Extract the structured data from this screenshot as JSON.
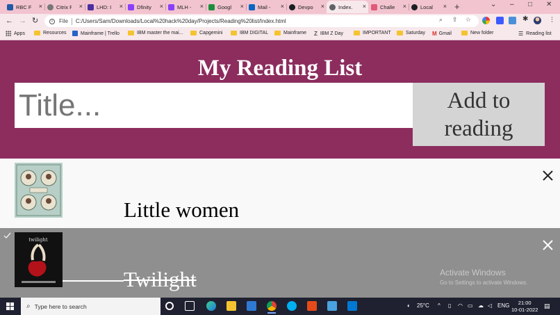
{
  "browser": {
    "tabs": [
      {
        "label": "RBC Fi",
        "color": "#1f5aa6"
      },
      {
        "label": "Citrix F",
        "color": "#555555"
      },
      {
        "label": "LHD: I",
        "color": "#4b2fa0"
      },
      {
        "label": "Dfinity",
        "color": "#8a3ffc"
      },
      {
        "label": "MLH -",
        "color": "#8a3ffc"
      },
      {
        "label": "Googl",
        "color": "#1e8e3e"
      },
      {
        "label": "Mail -",
        "color": "#0a66c2"
      },
      {
        "label": "Devpo",
        "color": "#1b1f23"
      },
      {
        "label": "Index.",
        "color": "#5f6368"
      },
      {
        "label": "Challe",
        "color": "#e05a7a"
      },
      {
        "label": "Local",
        "color": "#1b1f23"
      }
    ],
    "url_scheme": "File",
    "url": "C:/Users/Sam/Downloads/Local%20hack%20day/Projects/Reading%20list/Index.html",
    "bookmarks": [
      {
        "label": "Apps",
        "icon": "apps-grid-icon"
      },
      {
        "label": "Resources",
        "icon": "folder-icon"
      },
      {
        "label": "Mainframe | Trello",
        "icon": "trello-icon"
      },
      {
        "label": "IBM master the mai...",
        "icon": "folder-icon"
      },
      {
        "label": "Capgemini",
        "icon": "folder-icon"
      },
      {
        "label": "IBM DIGITAL",
        "icon": "folder-icon"
      },
      {
        "label": "Mainframe",
        "icon": "folder-icon"
      },
      {
        "label": "IBM Z Day",
        "icon": "z-icon"
      },
      {
        "label": "IMPORTANT",
        "icon": "folder-icon"
      },
      {
        "label": "Saturday",
        "icon": "folder-icon"
      },
      {
        "label": "Gmail",
        "icon": "gmail-icon"
      },
      {
        "label": "New folder",
        "icon": "folder-icon"
      }
    ],
    "reading_list_label": "Reading list"
  },
  "page": {
    "title": "My Reading List",
    "input_placeholder": "Title...",
    "add_button_label": "Add to reading",
    "books": [
      {
        "title": "Little women",
        "read": false
      },
      {
        "title": "Twilight",
        "read": true
      }
    ],
    "cover_twilight_text": "twilight"
  },
  "watermark": {
    "line1": "Activate Windows",
    "line2": "Go to Settings to activate Windows."
  },
  "taskbar": {
    "search_placeholder": "Type here to search",
    "temperature": "25°C",
    "language": "ENG",
    "time": "21:00",
    "date": "10-01-2022"
  },
  "colors": {
    "header_bg": "#8c2d5e",
    "tab_strip": "#f2c4cf",
    "read_item_bg": "#8f8f8f"
  }
}
